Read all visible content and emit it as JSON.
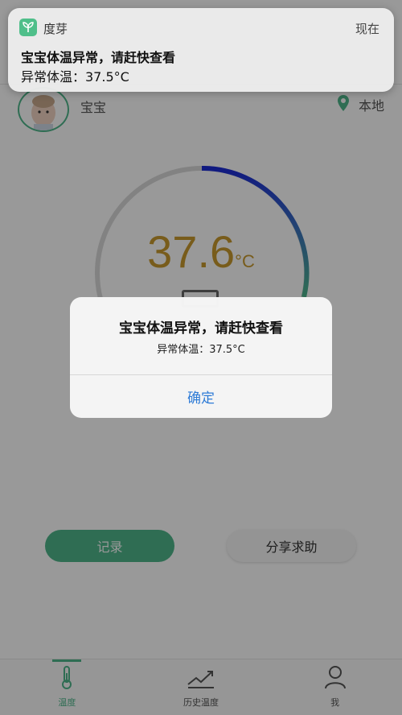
{
  "notification": {
    "app_name": "度芽",
    "time": "现在",
    "title": "宝宝体温异常，请赶快查看",
    "body": "异常体温：37.5°C"
  },
  "profile": {
    "name": "宝宝",
    "location": "本地"
  },
  "gauge": {
    "temperature": "37.6",
    "unit": "°C"
  },
  "buttons": {
    "record": "记录",
    "share": "分享求助"
  },
  "tabs": [
    {
      "label": "温度",
      "icon": "thermometer-icon",
      "active": true
    },
    {
      "label": "历史温度",
      "icon": "trend-chart-icon",
      "active": false
    },
    {
      "label": "我",
      "icon": "person-icon",
      "active": false
    }
  ],
  "alert": {
    "title": "宝宝体温异常，请赶快查看",
    "message": "异常体温：37.5°C",
    "confirm": "确定"
  },
  "colors": {
    "brand_green": "#4fb68b",
    "temp_text": "#c99a2e",
    "link_blue": "#2e7bd6"
  }
}
